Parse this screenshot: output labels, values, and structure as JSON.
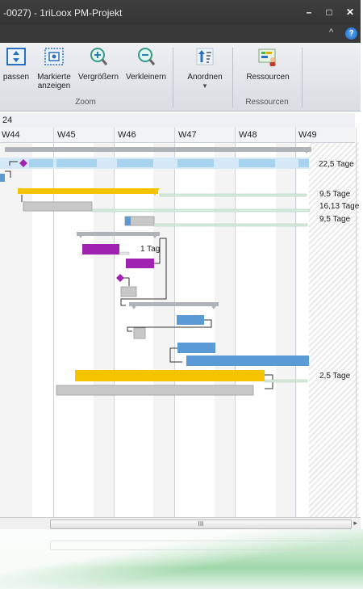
{
  "window": {
    "title": "-0027) - 1riLoox PM-Projekt",
    "controls": {
      "minimize": "–",
      "maximize": "□",
      "close": "✕"
    },
    "ribbon_collapse": "^",
    "help": "?"
  },
  "ribbon": {
    "zoom_group": {
      "label": "Zoom",
      "buttons": [
        {
          "label": "passen",
          "icon": "fit-icon"
        },
        {
          "label": "Markierte anzeigen",
          "icon": "show-selected-icon"
        },
        {
          "label": "Vergrößern",
          "icon": "zoom-in-icon"
        },
        {
          "label": "Verkleinern",
          "icon": "zoom-out-icon"
        }
      ]
    },
    "arrange_group": {
      "button": {
        "label": "Anordnen",
        "icon": "arrange-icon",
        "dropdown": "▾"
      }
    },
    "resources_group": {
      "label": "Ressourcen",
      "button": {
        "label": "Ressourcen",
        "icon": "resources-icon"
      }
    }
  },
  "timeline": {
    "top_label": "24",
    "weeks": [
      "W44",
      "W45",
      "W46",
      "W47",
      "W48",
      "W49"
    ]
  },
  "gantt": {
    "duration_labels": [
      "22,5 Tage",
      "9,5 Tage",
      "16,13 Tage",
      "9,5 Tage",
      "2,5 Tage"
    ],
    "bar_label": "1 Tag",
    "colors": {
      "summary": "#a9adb3",
      "highlight": "#a8d3ef",
      "task_blue": "#5b9bd5",
      "task_yellow": "#f5c400",
      "task_purple": "#a022b0",
      "task_gray": "#c8c8c8"
    }
  },
  "scrollbar": {
    "grip": "III",
    "right_arrow": "▸"
  }
}
